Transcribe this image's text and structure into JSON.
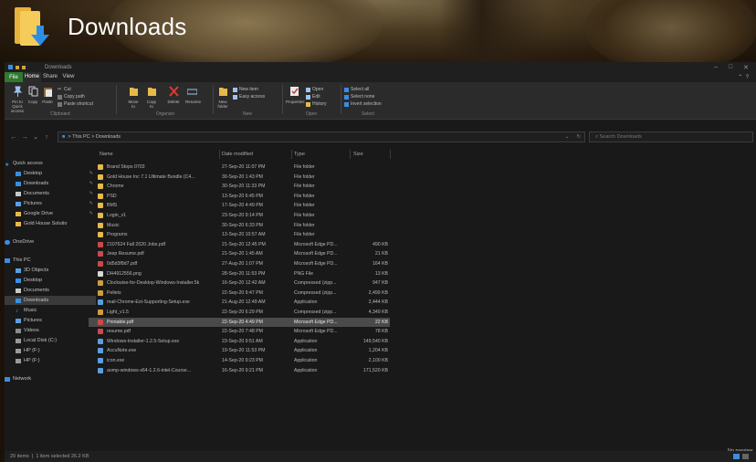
{
  "desktop": {
    "title": "Downloads"
  },
  "titlebar": {
    "title": "Downloads"
  },
  "ribbon_tabs": {
    "file": "File",
    "home": "Home",
    "share": "Share",
    "view": "View"
  },
  "ribbon": {
    "clipboard": {
      "pin": "Pin to Quick access",
      "copy": "Copy",
      "paste": "Paste",
      "cut": "Cut",
      "copy_path": "Copy path",
      "paste_shortcut": "Paste shortcut",
      "label": "Clipboard"
    },
    "organize": {
      "move_to": "Move to",
      "copy_to": "Copy to",
      "delete": "Delete",
      "rename": "Rename",
      "label": "Organize"
    },
    "new": {
      "new_folder": "New folder",
      "new_item": "New item",
      "easy_access": "Easy access",
      "label": "New"
    },
    "open": {
      "properties": "Properties",
      "open": "Open",
      "edit": "Edit",
      "history": "History",
      "label": "Open"
    },
    "select": {
      "select_all": "Select all",
      "select_none": "Select none",
      "invert": "Invert selection",
      "label": "Select"
    }
  },
  "address": {
    "this_pc": "This PC",
    "sep": ">",
    "folder": "Downloads",
    "search_placeholder": "Search Downloads"
  },
  "nav": {
    "quick_access": "Quick access",
    "desktop": "Desktop",
    "downloads": "Downloads",
    "documents": "Documents",
    "pictures": "Pictures",
    "google_drive": "Google Drive",
    "gold_house": "Gold House Solutio",
    "onedrive": "OneDrive",
    "this_pc": "This PC",
    "objects3d": "3D Objects",
    "desktop2": "Desktop",
    "documents2": "Documents",
    "downloads2": "Downloads",
    "music": "Music",
    "pictures2": "Pictures",
    "videos": "Videos",
    "local_disk": "Local Disk (C:)",
    "hp1": "HP (F:)",
    "hp2": "HP (F:)",
    "network": "Network"
  },
  "columns": {
    "name": "Name",
    "date": "Date modified",
    "type": "Type",
    "size": "Size"
  },
  "files": [
    {
      "name": "Brand Stops 0703",
      "date": "27-Sep-20 11:07 PM",
      "type": "File folder",
      "size": "",
      "kind": "folder"
    },
    {
      "name": "Gold House Inc 7.1 Ultimate Bundle (C4...",
      "date": "30-Sep-20 1:43 PM",
      "type": "File folder",
      "size": "",
      "kind": "folder"
    },
    {
      "name": "Chrome",
      "date": "30-Sep-20 11:33 PM",
      "type": "File folder",
      "size": "",
      "kind": "folder"
    },
    {
      "name": "PSD",
      "date": "13-Sep-20 6:45 PM",
      "type": "File folder",
      "size": "",
      "kind": "folder"
    },
    {
      "name": "BMS",
      "date": "17-Sep-20 4:49 PM",
      "type": "File folder",
      "size": "",
      "kind": "folder"
    },
    {
      "name": "Login_v1",
      "date": "23-Sep-20 9:14 PM",
      "type": "File folder",
      "size": "",
      "kind": "folder"
    },
    {
      "name": "Music",
      "date": "30-Sep-20 6:33 PM",
      "type": "File folder",
      "size": "",
      "kind": "folder"
    },
    {
      "name": "Programs",
      "date": "13-Sep-20 10:57 AM",
      "type": "File folder",
      "size": "",
      "kind": "folder"
    },
    {
      "name": "2107624 Fall 2020 Jobs.pdf",
      "date": "21-Sep-20 12:45 PM",
      "type": "Microsoft Edge PD...",
      "size": "490 KB",
      "kind": "pdf"
    },
    {
      "name": "Jeep Resume.pdf",
      "date": "21-Sep-20 1:45 AM",
      "type": "Microsoft Edge PD...",
      "size": "21 KB",
      "kind": "pdf"
    },
    {
      "name": "0d5d3f8d7.pdf",
      "date": "27-Aug-20 1:07 PM",
      "type": "Microsoft Edge PD...",
      "size": "164 KB",
      "kind": "pdf"
    },
    {
      "name": "DH4912556.png",
      "date": "28-Sep-20 11:53 PM",
      "type": "PNG File",
      "size": "13 KB",
      "kind": "png"
    },
    {
      "name": "Clockwise-for-Desktop-Windows-Installer.5k",
      "date": "16-Sep-20 12:42 AM",
      "type": "Compressed (zipp...",
      "size": "947 KB",
      "kind": "zip"
    },
    {
      "name": "Pellets",
      "date": "22-Sep-20 9:47 PM",
      "type": "Compressed (zipp...",
      "size": "2,499 KB",
      "kind": "zip"
    },
    {
      "name": "mail-Chrome-Ext-Supporting-Setup.exe",
      "date": "21-Aug-20 12:49 AM",
      "type": "Application",
      "size": "2,444 KB",
      "kind": "exe"
    },
    {
      "name": "Light_v1.5",
      "date": "22-Sep-20 6:29 PM",
      "type": "Compressed (zipp...",
      "size": "4,349 KB",
      "kind": "zip"
    },
    {
      "name": "Printable.pdf",
      "date": "22-Sep-20 4:49 PM",
      "type": "Microsoft Edge PD...",
      "size": "22 KB",
      "kind": "pdf"
    },
    {
      "name": "resume.pdf",
      "date": "22-Sep-20 7:48 PM",
      "type": "Microsoft Edge PD...",
      "size": "78 KB",
      "kind": "pdf"
    },
    {
      "name": "Windows-Installer-1.2.5-Setup.exe",
      "date": "23-Sep-20 9:51 AM",
      "type": "Application",
      "size": "149,540 KB",
      "kind": "exe"
    },
    {
      "name": "AccuNote.exe",
      "date": "19-Sep-20 11:53 PM",
      "type": "Application",
      "size": "1,204 KB",
      "kind": "exe"
    },
    {
      "name": "icon.exe",
      "date": "14-Sep-20 9:23 PM",
      "type": "Application",
      "size": "2,100 KB",
      "kind": "exe"
    },
    {
      "name": "aomp-windows-x64-1.2.6-intel-Course...",
      "date": "16-Sep-20 9:21 PM",
      "type": "Application",
      "size": "171,520 KB",
      "kind": "exe"
    }
  ],
  "selected_index": 16,
  "preview_text": "No preview available.",
  "status": {
    "items": "20 items",
    "selected": "1 item selected  26.2 KB"
  },
  "colors": {
    "folder": "#e6b94a",
    "pdf": "#c94a4a",
    "png": "#d8d8d8",
    "zip": "#cf9e3c",
    "exe": "#5a9ee0",
    "accent": "#3a8de0"
  }
}
